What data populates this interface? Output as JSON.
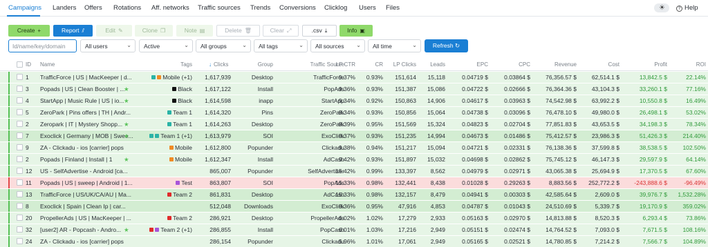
{
  "nav": {
    "tabs": [
      "Campaigns",
      "Landers",
      "Offers",
      "Rotations",
      "Aff. networks",
      "Traffic sources",
      "Trends",
      "Conversions",
      "Clicklog",
      "Users",
      "Files"
    ],
    "help": "Help"
  },
  "toolbar": {
    "create": "Create",
    "report": "Report",
    "edit": "Edit",
    "clone": "Clone",
    "note": "Note",
    "delete": "Delete",
    "clear": "Clear",
    "csv": ".csv",
    "info": "Info"
  },
  "filters": {
    "search_placeholder": "Id/name/key/domain",
    "users": "All users",
    "status": "Active",
    "groups": "All groups",
    "tags": "All tags",
    "sources": "All sources",
    "time": "All time",
    "refresh": "Refresh"
  },
  "columns": [
    "ID",
    "Name",
    "Tags",
    "Clicks",
    "Group",
    "Traffic Source",
    "LP CTR",
    "CR",
    "LP Clicks",
    "Leads",
    "EPC",
    "CPC",
    "Revenue",
    "Cost",
    "Profit",
    "ROI"
  ],
  "colors": {
    "accent": "#1a7fd4",
    "green_btn": "#8fd96a",
    "positive": "#2f9a3a",
    "negative": "#d93030"
  },
  "rows": [
    {
      "id": "1",
      "name": "TrafficForce | US | MacKeeper | d...",
      "tags": "Mobile (+1)",
      "tag_colors": [
        "#2ab3a6",
        "#f08a24"
      ],
      "clicks": "1,617,939",
      "group": "Desktop",
      "source": "TrafficForce",
      "lpctr": "9.37%",
      "cr": "0.93%",
      "lpclicks": "151,614",
      "leads": "15,118",
      "epc": "0.04719 $",
      "cpc": "0.03864 $",
      "revenue": "76,356.57 $",
      "cost": "62,514.1 $",
      "profit": "13,842.5 $",
      "roi": "22.14%",
      "profit_neg": false,
      "bg": "green",
      "star": false
    },
    {
      "id": "3",
      "name": "Popads | US | Clean Booster | ...",
      "tags": "Black",
      "tag_colors": [
        "#111111"
      ],
      "clicks": "1,617,122",
      "group": "Install",
      "source": "PopAds",
      "lpctr": "9.36%",
      "cr": "0.93%",
      "lpclicks": "151,387",
      "leads": "15,086",
      "epc": "0.04722 $",
      "cpc": "0.02666 $",
      "revenue": "76,364.36 $",
      "cost": "43,104.3 $",
      "profit": "33,260.1 $",
      "roi": "77.16%",
      "profit_neg": false,
      "bg": "green",
      "star": true
    },
    {
      "id": "4",
      "name": "StartApp | Music Rule | US | io...",
      "tags": "Black",
      "tag_colors": [
        "#111111"
      ],
      "clicks": "1,614,598",
      "group": "inapp",
      "source": "StartApp",
      "lpctr": "9.34%",
      "cr": "0.92%",
      "lpclicks": "150,863",
      "leads": "14,906",
      "epc": "0.04617 $",
      "cpc": "0.03963 $",
      "revenue": "74,542.98 $",
      "cost": "63,992.2 $",
      "profit": "10,550.8 $",
      "roi": "16.49%",
      "profit_neg": false,
      "bg": "green",
      "star": true
    },
    {
      "id": "5",
      "name": "ZeroPark | Pins offers | TH | Andr...",
      "tags": "Team 1",
      "tag_colors": [
        "#2ab3a6"
      ],
      "clicks": "1,614,320",
      "group": "Pins",
      "source": "ZeroPark",
      "lpctr": "9.34%",
      "cr": "0.93%",
      "lpclicks": "150,856",
      "leads": "15,064",
      "epc": "0.04738 $",
      "cpc": "0.03096 $",
      "revenue": "76,478.10 $",
      "cost": "49,980.0 $",
      "profit": "26,498.1 $",
      "roi": "53.02%",
      "profit_neg": false,
      "bg": "green",
      "star": false
    },
    {
      "id": "2",
      "name": "Zeropark | IT | Mystery Shopp...",
      "tags": "Team 1",
      "tag_colors": [
        "#2ab3a6"
      ],
      "clicks": "1,614,263",
      "group": "Desktop",
      "source": "ZeroPark",
      "lpctr": "9.39%",
      "cr": "0.95%",
      "lpclicks": "151,569",
      "leads": "15,324",
      "epc": "0.04823 $",
      "cpc": "0.02704 $",
      "revenue": "77,851.83 $",
      "cost": "43,653.5 $",
      "profit": "34,198.3 $",
      "roi": "78.34%",
      "profit_neg": false,
      "bg": "green",
      "star": true
    },
    {
      "id": "7",
      "name": "Exoclick | Germany | MOB | Swee...",
      "tags": "Team 1 (+1)",
      "tag_colors": [
        "#2ab3a6",
        "#2ab3a6"
      ],
      "clicks": "1,613,979",
      "group": "SOI",
      "source": "ExoClick",
      "lpctr": "9.37%",
      "cr": "0.93%",
      "lpclicks": "151,235",
      "leads": "14,994",
      "epc": "0.04673 $",
      "cpc": "0.01486 $",
      "revenue": "75,412.57 $",
      "cost": "23,986.3 $",
      "profit": "51,426.3 $",
      "roi": "214.40%",
      "profit_neg": false,
      "bg": "dgreen",
      "star": true
    },
    {
      "id": "9",
      "name": "ZA - Clickadu - ios [carrier] pops",
      "tags": "Mobile",
      "tag_colors": [
        "#f08a24"
      ],
      "clicks": "1,612,800",
      "group": "Popunder",
      "source": "Clickadu",
      "lpctr": "9.38%",
      "cr": "0.94%",
      "lpclicks": "151,217",
      "leads": "15,094",
      "epc": "0.04721 $",
      "cpc": "0.02331 $",
      "revenue": "76,138.36 $",
      "cost": "37,599.8 $",
      "profit": "38,538.5 $",
      "roi": "102.50%",
      "profit_neg": false,
      "bg": "green",
      "star": false
    },
    {
      "id": "2",
      "name": "Popads | Finland | Install | 1",
      "tags": "Mobile",
      "tag_colors": [
        "#f08a24"
      ],
      "clicks": "1,612,347",
      "group": "Install",
      "source": "AdCash",
      "lpctr": "9.42%",
      "cr": "0.93%",
      "lpclicks": "151,897",
      "leads": "15,032",
      "epc": "0.04698 $",
      "cpc": "0.02862 $",
      "revenue": "75,745.12 $",
      "cost": "46,147.3 $",
      "profit": "29,597.9 $",
      "roi": "64.14%",
      "profit_neg": false,
      "bg": "green",
      "star": true
    },
    {
      "id": "12",
      "name": "US - SelfAdvertise - Android [ca...",
      "tags": "",
      "tag_colors": [],
      "clicks": "865,007",
      "group": "Popunder",
      "source": "SelfAdvertiser",
      "lpctr": "15.42%",
      "cr": "0.99%",
      "lpclicks": "133,397",
      "leads": "8,562",
      "epc": "0.04979 $",
      "cpc": "0.02971 $",
      "revenue": "43,065.38 $",
      "cost": "25,694.9 $",
      "profit": "17,370.5 $",
      "roi": "67.60%",
      "profit_neg": false,
      "bg": "green",
      "star": false
    },
    {
      "id": "11",
      "name": "Popads | US | sweep | Android | 1...",
      "tags": "Test",
      "tag_colors": [
        "#a855d9"
      ],
      "clicks": "863,807",
      "group": "SOI",
      "source": "PopAds",
      "lpctr": "15.33%",
      "cr": "0.98%",
      "lpclicks": "132,441",
      "leads": "8,438",
      "epc": "0.01028 $",
      "cpc": "0.29263 $",
      "revenue": "8,883.56 $",
      "cost": "252,772.2 $",
      "profit": "-243,888.6 $",
      "roi": "-96.49%",
      "profit_neg": true,
      "bg": "red",
      "star": false
    },
    {
      "id": "13",
      "name": "TrafficForce | US/UK/CA/AU | Ma...",
      "tags": "Team 2",
      "tag_colors": [
        "#e02b2b"
      ],
      "clicks": "861,831",
      "group": "Desktop",
      "source": "AdCash",
      "lpctr": "15.33%",
      "cr": "0.98%",
      "lpclicks": "132,157",
      "leads": "8,479",
      "epc": "0.04941 $",
      "cpc": "0.00303 $",
      "revenue": "42,585.64 $",
      "cost": "2,609.0 $",
      "profit": "39,976.7 $",
      "roi": "1,532.28%",
      "profit_neg": false,
      "bg": "dgreen",
      "star": false
    },
    {
      "id": "8",
      "name": "Exoclick | Spain | Clean Ip | car...",
      "tags": "",
      "tag_colors": [],
      "clicks": "512,048",
      "group": "Downloads",
      "source": "ExoClick",
      "lpctr": "9.36%",
      "cr": "0.95%",
      "lpclicks": "47,916",
      "leads": "4,853",
      "epc": "0.04787 $",
      "cpc": "0.01043 $",
      "revenue": "24,510.69 $",
      "cost": "5,339.7 $",
      "profit": "19,170.9 $",
      "roi": "359.02%",
      "profit_neg": false,
      "bg": "dgreen",
      "star": false
    },
    {
      "id": "20",
      "name": "PropellerAds | US | MacKeeper | ...",
      "tags": "Team 2",
      "tag_colors": [
        "#e02b2b"
      ],
      "clicks": "286,921",
      "group": "Desktop",
      "source": "PropellerAds",
      "lpctr": "6.02%",
      "cr": "1.02%",
      "lpclicks": "17,279",
      "leads": "2,933",
      "epc": "0.05163 $",
      "cpc": "0.02970 $",
      "revenue": "14,813.88 $",
      "cost": "8,520.3 $",
      "profit": "6,293.4 $",
      "roi": "73.86%",
      "profit_neg": false,
      "bg": "green",
      "star": false
    },
    {
      "id": "32",
      "name": "[user2] AR - Popcash - Andro...",
      "tags": "Team 2 (+1)",
      "tag_colors": [
        "#e02b2b",
        "#a855d9"
      ],
      "clicks": "286,855",
      "group": "Install",
      "source": "PopCash",
      "lpctr": "6.01%",
      "cr": "1.03%",
      "lpclicks": "17,216",
      "leads": "2,949",
      "epc": "0.05151 $",
      "cpc": "0.02474 $",
      "revenue": "14,764.52 $",
      "cost": "7,093.0 $",
      "profit": "7,671.5 $",
      "roi": "108.16%",
      "profit_neg": false,
      "bg": "green",
      "star": true
    },
    {
      "id": "24",
      "name": "ZA - Clickadu - ios [carrier] pops",
      "tags": "",
      "tag_colors": [],
      "clicks": "286,154",
      "group": "Popunder",
      "source": "Clickadu",
      "lpctr": "5.96%",
      "cr": "1.01%",
      "lpclicks": "17,061",
      "leads": "2,949",
      "epc": "0.05165 $",
      "cpc": "0.02521 $",
      "revenue": "14,780.85 $",
      "cost": "7,214.2 $",
      "profit": "7,566.7 $",
      "roi": "104.89%",
      "profit_neg": false,
      "bg": "green",
      "star": false
    }
  ]
}
